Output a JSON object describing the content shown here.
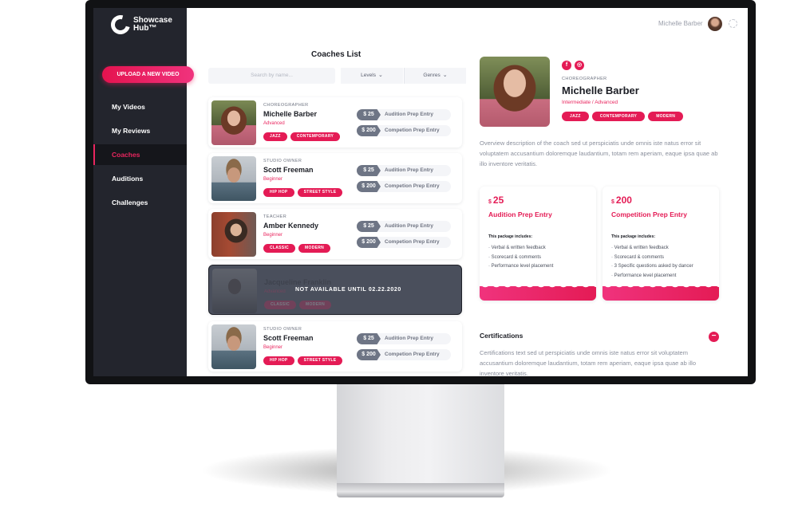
{
  "app": {
    "logo_line1": "Showcase",
    "logo_line2": "Hub™"
  },
  "sidebar": {
    "upload_label": "UPLOAD A NEW VIDEO",
    "items": [
      {
        "label": "My Videos"
      },
      {
        "label": "My Reviews"
      },
      {
        "label": "Coaches"
      },
      {
        "label": "Auditions"
      },
      {
        "label": "Challenges"
      }
    ],
    "active": "Coaches"
  },
  "header": {
    "user_name": "Michelle Barber"
  },
  "list": {
    "title": "Coaches List",
    "search_placeholder": "Search by name...",
    "filter_levels": "Levels",
    "filter_genres": "Genres",
    "coaches": [
      {
        "role": "CHOREOGRAPHER",
        "name": "Michelle Barber",
        "level": "Advanced",
        "tags": [
          "JAZZ",
          "CONTEMPORARY"
        ],
        "entries": [
          {
            "price": "$ 25",
            "label": "Audition Prep Entry"
          },
          {
            "price": "$ 200",
            "label": "Competion Prep Entry"
          }
        ]
      },
      {
        "role": "STUDIO OWNER",
        "name": "Scott Freeman",
        "level": "Beginner",
        "tags": [
          "HIP HOP",
          "STREET STYLE"
        ],
        "entries": [
          {
            "price": "$ 25",
            "label": "Audition Prep Entry"
          },
          {
            "price": "$ 200",
            "label": "Competion Prep Entry"
          }
        ]
      },
      {
        "role": "TEACHER",
        "name": "Amber Kennedy",
        "level": "Beginner",
        "tags": [
          "CLASSIC",
          "MODERN"
        ],
        "entries": [
          {
            "price": "$ 25",
            "label": "Audition Prep Entry"
          },
          {
            "price": "$ 200",
            "label": "Competion Prep Entry"
          }
        ]
      },
      {
        "role": "",
        "name": "Jacqueline Franklin",
        "level": "Advanced",
        "tags": [
          "CLASSIC",
          "MODERN"
        ],
        "unavailable": "NOT AVAILABLE UNTIL 02.22.2020"
      },
      {
        "role": "STUDIO OWNER",
        "name": "Scott Freeman",
        "level": "Beginner",
        "tags": [
          "HIP HOP",
          "STREET STYLE"
        ],
        "entries": [
          {
            "price": "$ 25",
            "label": "Audition Prep Entry"
          },
          {
            "price": "$ 200",
            "label": "Competion Prep Entry"
          }
        ]
      }
    ]
  },
  "detail": {
    "role": "CHOREOGRAPHER",
    "name": "Michelle Barber",
    "level": "Intermediate / Advanced",
    "tags": [
      "JAZZ",
      "CONTEMPORARY",
      "MODERN"
    ],
    "social": [
      "f",
      "◎"
    ],
    "overview": "Overview description of the coach sed ut perspiciatis unde omnis iste natus error sit voluptatem accusantium doloremque laudantium, totam rem aperiam, eaque ipsa quae ab illo inventore veritatis.",
    "packages": [
      {
        "currency": "$",
        "amount": "25",
        "title": "Audition Prep Entry",
        "includes": "This package includes:",
        "items": [
          "· Verbal & written feedback",
          "· Scorecard & comments",
          "· Performance level placement"
        ]
      },
      {
        "currency": "$",
        "amount": "200",
        "title": "Competition Prep Entry",
        "includes": "This package includes:",
        "items": [
          "· Verbal & written feedback",
          "· Scorecard & comments",
          "· 3 Specific questions asked by dancer",
          "· Performance level placement"
        ]
      }
    ],
    "cert_title": "Certifications",
    "cert_toggle": "−",
    "cert_text": "Certifications text sed ut perspiciatis unde omnis iste natus error sit voluptatem accusantium doloremque laudantium, totam rem aperiam, eaque ipsa quae ab illo inventore veritatis."
  },
  "colors": {
    "accent": "#e41b55",
    "sidebar": "#23252d",
    "price_badge": "#6e7585"
  }
}
